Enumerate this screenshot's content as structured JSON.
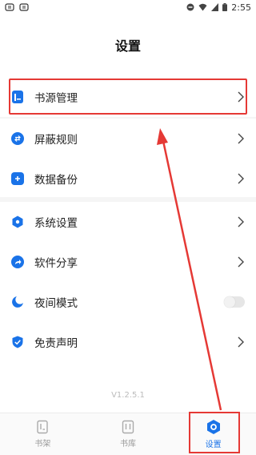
{
  "status": {
    "time": "2:55"
  },
  "title": "设置",
  "menu": {
    "group1": [
      {
        "label": "书源管理",
        "icon": "book-source-icon"
      }
    ],
    "group2": [
      {
        "label": "屏蔽规则",
        "icon": "swap-icon"
      },
      {
        "label": "数据备份",
        "icon": "backup-icon"
      }
    ],
    "group3": [
      {
        "label": "系统设置",
        "icon": "hexagon-icon"
      },
      {
        "label": "软件分享",
        "icon": "share-icon"
      },
      {
        "label": "夜间模式",
        "icon": "moon-icon",
        "toggle_on": false
      },
      {
        "label": "免责声明",
        "icon": "shield-check-icon"
      }
    ]
  },
  "version": "V1.2.5.1",
  "tabs": [
    {
      "label": "书架",
      "icon": "bookshelf-icon",
      "active": false
    },
    {
      "label": "书库",
      "icon": "library-icon",
      "active": false
    },
    {
      "label": "设置",
      "icon": "settings-hex-icon",
      "active": true
    }
  ],
  "colors": {
    "accent": "#1a73e8",
    "annotation": "#e53935"
  }
}
